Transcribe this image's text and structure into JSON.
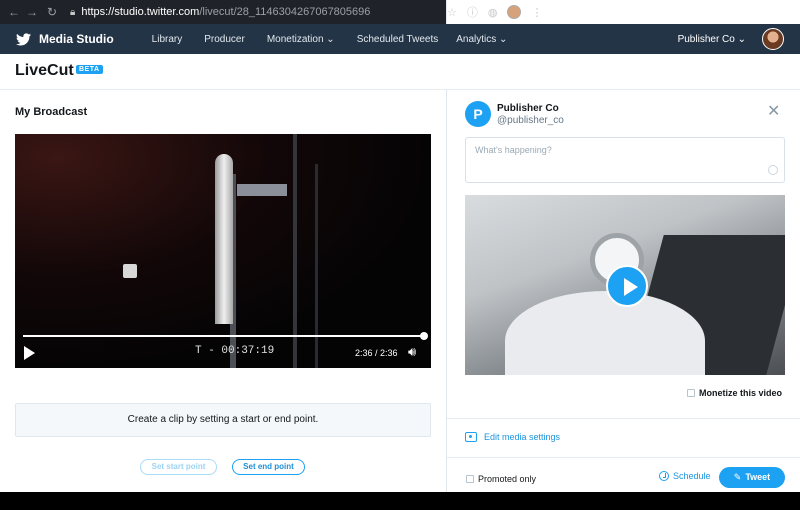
{
  "browser": {
    "url_host": "https://studio.twitter.com",
    "url_path": "/livecut/28_1146304267067805696"
  },
  "appnav": {
    "brand": "Media Studio",
    "links": [
      "Library",
      "Producer",
      "Monetization ⌄",
      "Scheduled Tweets",
      "Analytics ⌄"
    ],
    "account": "Publisher Co ⌄"
  },
  "page": {
    "title": "LiveCut",
    "badge": "BETA"
  },
  "broadcast": {
    "heading": "My Broadcast",
    "overlay_text": "T - 00:37:19",
    "time": "2:36 / 2:36",
    "progress": 1.0,
    "clip_hint": "Create a clip by setting a start or end point.",
    "set_start": "Set start point",
    "set_end": "Set end point"
  },
  "composer": {
    "avatar_letter": "P",
    "name": "Publisher Co",
    "handle": "@publisher_co",
    "placeholder": "What's happening?",
    "monetize_label": "Monetize this video",
    "edit_media": "Edit media settings",
    "promoted_only": "Promoted only",
    "schedule": "Schedule",
    "tweet": "Tweet"
  },
  "colors": {
    "twitter_blue": "#1da1f2",
    "nav_bg": "#243447",
    "chrome_bg": "#1f2329"
  }
}
